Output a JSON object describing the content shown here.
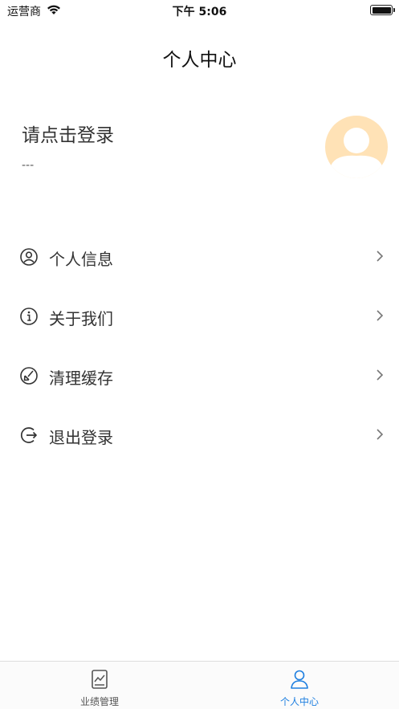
{
  "status_bar": {
    "carrier": "运营商",
    "time": "下午 5:06"
  },
  "nav": {
    "title": "个人中心"
  },
  "profile": {
    "login_prompt": "请点击登录",
    "subtitle": "---"
  },
  "menu": [
    {
      "label": "个人信息",
      "icon": "user-circle-icon"
    },
    {
      "label": "关于我们",
      "icon": "info-icon"
    },
    {
      "label": "清理缓存",
      "icon": "clean-icon"
    },
    {
      "label": "退出登录",
      "icon": "logout-icon"
    }
  ],
  "tab_bar": {
    "tabs": [
      {
        "label": "业绩管理",
        "icon": "chart-document-icon",
        "active": false
      },
      {
        "label": "个人中心",
        "icon": "user-icon",
        "active": true
      }
    ],
    "active_color": "#1e7fe0",
    "inactive_color": "#555555"
  },
  "colors": {
    "avatar_bg": "#ffe2b6",
    "avatar_fg": "#ffffff"
  }
}
